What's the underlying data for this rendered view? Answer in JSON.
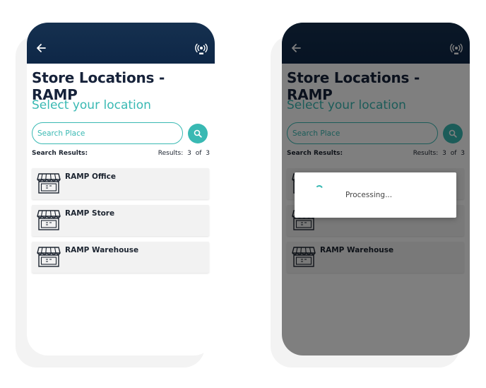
{
  "colors": {
    "appbar": "#0e2747",
    "accent": "#39b9b3",
    "title": "#16223a",
    "item_bg": "#f2f2f2"
  },
  "screens": [
    {
      "appbar": {
        "back_icon": "arrow-left-icon",
        "rfid_icon": "rfid-icon"
      },
      "title": "Store Locations - RAMP",
      "subtitle": "Select your location",
      "search": {
        "placeholder": "Search Place",
        "value": "",
        "button_icon": "search-icon"
      },
      "results_label": "Search Results:",
      "results_count": "Results: 3 of 3",
      "items": [
        {
          "label": "RAMP Office",
          "icon": "store-icon"
        },
        {
          "label": "RAMP Store",
          "icon": "store-icon"
        },
        {
          "label": "RAMP Warehouse",
          "icon": "store-icon"
        }
      ]
    },
    {
      "appbar": {
        "back_icon": "arrow-left-icon",
        "rfid_icon": "rfid-icon"
      },
      "title": "Store Locations - RAMP",
      "subtitle": "Select your location",
      "search": {
        "placeholder": "Search Place",
        "value": "",
        "button_icon": "search-icon"
      },
      "results_label": "Search Results:",
      "results_count": "Results: 3 of 3",
      "items": [
        {
          "label": "",
          "icon": "store-icon"
        },
        {
          "label": "",
          "icon": "store-icon"
        },
        {
          "label": "RAMP Warehouse",
          "icon": "store-icon"
        }
      ],
      "dialog": {
        "text": "Processing...",
        "spinner_icon": "spinner-icon"
      }
    }
  ]
}
